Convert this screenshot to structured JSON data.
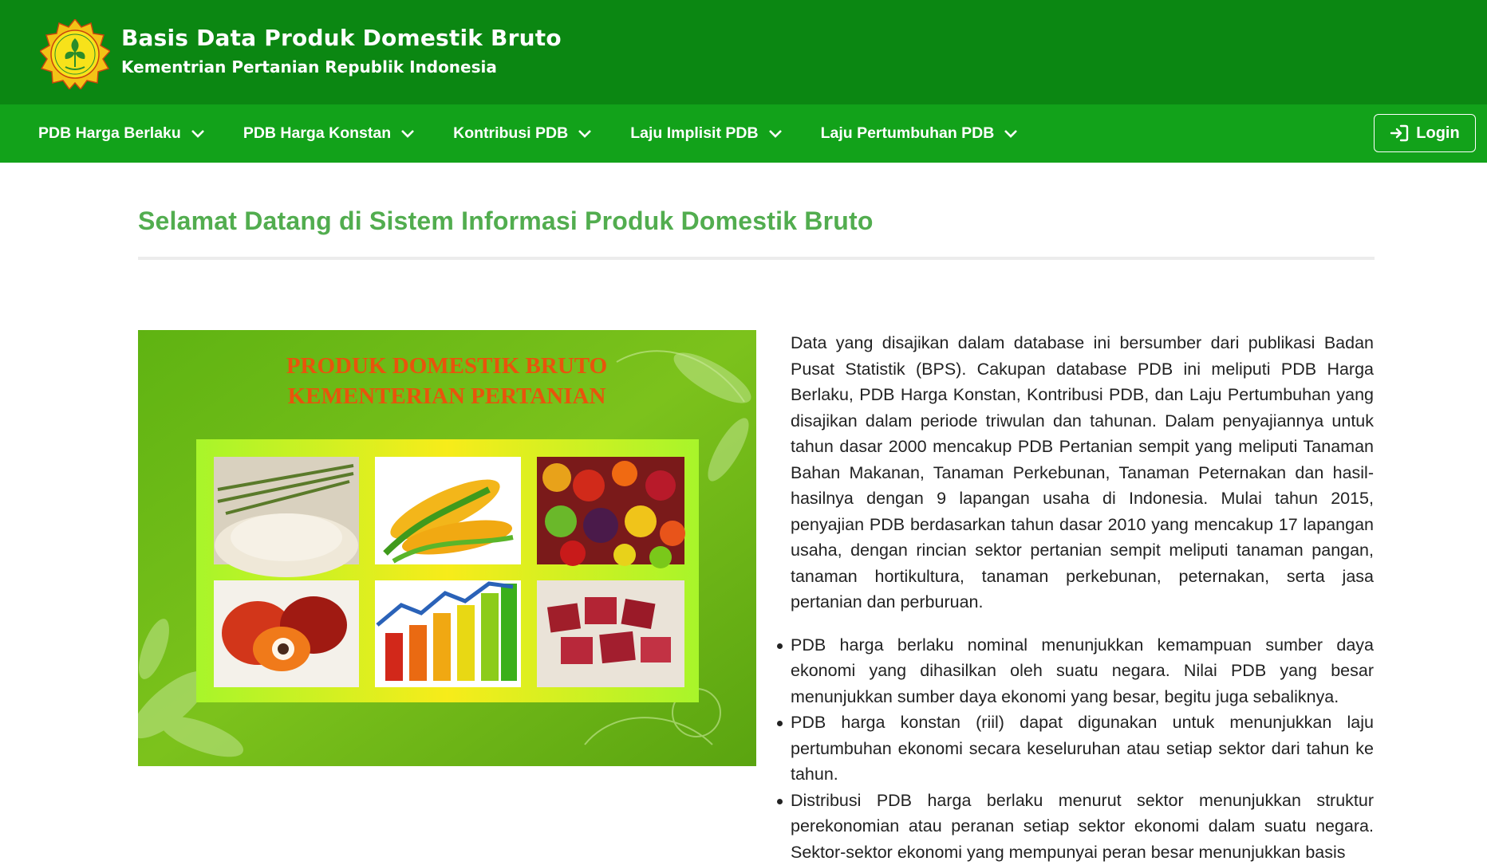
{
  "header": {
    "title": "Basis Data Produk Domestik Bruto",
    "subtitle": "Kementrian Pertanian Republik Indonesia",
    "logo_icon": "ministry-of-agriculture-emblem"
  },
  "nav": {
    "items": [
      {
        "label": "PDB Harga Berlaku"
      },
      {
        "label": "PDB Harga Konstan"
      },
      {
        "label": "Kontribusi PDB"
      },
      {
        "label": "Laju Implisit PDB"
      },
      {
        "label": "Laju Pertumbuhan PDB"
      }
    ],
    "login_label": "Login",
    "login_icon": "sign-in-icon"
  },
  "main": {
    "welcome_title": "Selamat Datang di Sistem Informasi Produk Domestik Bruto",
    "banner": {
      "title_line1": "PRODUK DOMESTIK BRUTO",
      "title_line2": "KEMENTERIAN PERTANIAN"
    },
    "intro": "Data yang disajikan dalam database ini bersumber dari publikasi Badan Pusat Statistik (BPS). Cakupan database PDB ini meliputi PDB Harga Berlaku, PDB Harga Konstan, Kontribusi PDB, dan Laju Pertumbuhan yang disajikan dalam periode triwulan dan tahunan. Dalam penyajiannya untuk tahun dasar 2000 mencakup PDB Pertanian sempit yang meliputi Tanaman Bahan Makanan, Tanaman Perkebunan, Tanaman Peternakan dan hasil-hasilnya dengan 9 lapangan usaha di Indonesia. Mulai tahun 2015, penyajian PDB berdasarkan tahun dasar 2010 yang mencakup 17 lapangan usaha, dengan rincian sektor pertanian sempit meliputi tanaman pangan, tanaman hortikultura, tanaman perkebunan, peternakan, serta jasa pertanian dan perburuan.",
    "bullets": [
      "PDB harga berlaku nominal menunjukkan kemampuan sumber daya ekonomi yang dihasilkan oleh suatu negara. Nilai PDB yang besar menunjukkan sumber daya ekonomi yang besar, begitu juga sebaliknya.",
      "PDB harga konstan (riil) dapat digunakan untuk menunjukkan laju pertumbuhan ekonomi secara keseluruhan atau setiap sektor dari tahun ke tahun.",
      "Distribusi PDB harga berlaku menurut sektor menunjukkan struktur perekonomian atau peranan setiap sektor ekonomi dalam suatu negara. Sektor-sektor ekonomi yang mempunyai peran besar menunjukkan basis"
    ]
  },
  "colors": {
    "header_bg": "#0b8712",
    "navbar_bg": "#12a21a",
    "welcome_text": "#52ad4f",
    "banner_title": "#e8540c"
  }
}
